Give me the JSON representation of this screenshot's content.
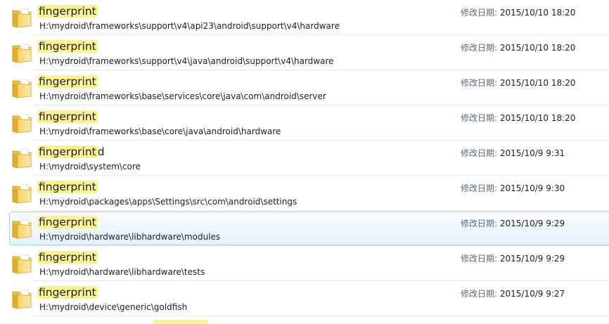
{
  "results": [
    {
      "match": "fingerprint",
      "rest": "",
      "path": "H:\\mydroid\\frameworks\\support\\v4\\api23\\android\\support\\v4\\hardware",
      "date_label": "修改日期:",
      "date": "2015/10/10 18:20"
    },
    {
      "match": "fingerprint",
      "rest": "",
      "path": "H:\\mydroid\\frameworks\\support\\v4\\java\\android\\support\\v4\\hardware",
      "date_label": "修改日期:",
      "date": "2015/10/10 18:20"
    },
    {
      "match": "fingerprint",
      "rest": "",
      "path": "H:\\mydroid\\frameworks\\base\\services\\core\\java\\com\\android\\server",
      "date_label": "修改日期:",
      "date": "2015/10/10 18:20"
    },
    {
      "match": "fingerprint",
      "rest": "",
      "path": "H:\\mydroid\\frameworks\\base\\core\\java\\android\\hardware",
      "date_label": "修改日期:",
      "date": "2015/10/10 18:20"
    },
    {
      "match": "fingerprint",
      "rest": "d",
      "path": "H:\\mydroid\\system\\core",
      "date_label": "修改日期:",
      "date": "2015/10/9 9:31"
    },
    {
      "match": "fingerprint",
      "rest": "",
      "path": "H:\\mydroid\\packages\\apps\\Settings\\src\\com\\android\\settings",
      "date_label": "修改日期:",
      "date": "2015/10/9 9:30"
    },
    {
      "match": "fingerprint",
      "rest": "",
      "path": "H:\\mydroid\\hardware\\libhardware\\modules",
      "date_label": "修改日期:",
      "date": "2015/10/9 9:29",
      "selected": true
    },
    {
      "match": "fingerprint",
      "rest": "",
      "path": "H:\\mydroid\\hardware\\libhardware\\tests",
      "date_label": "修改日期:",
      "date": "2015/10/9 9:29"
    },
    {
      "match": "fingerprint",
      "rest": "",
      "path": "H:\\mydroid\\device\\generic\\goldfish",
      "date_label": "修改日期:",
      "date": "2015/10/9 9:27"
    }
  ],
  "highlight_color": "#fbf38d",
  "selection_border": "#a9cdee",
  "icon": "folder-icon"
}
